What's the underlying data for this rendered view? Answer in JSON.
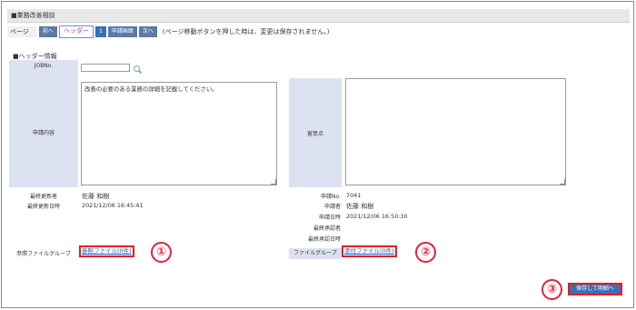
{
  "title": "■業務改善相談",
  "pager": {
    "label": "ページ",
    "prev": "前へ",
    "header_tab": "ヘッダー",
    "page_num": "1",
    "screen_btn": "申請画面",
    "next": "次へ",
    "note": "(ページ移動ボタンを押した時は、変更は保存されません。)"
  },
  "section": "■ヘッダー情報",
  "left": {
    "jobno_label": "JOBNo.",
    "jobno_value": "",
    "content_label": "申請内容",
    "content_text": "改善の必要のある業務の詳細を記載してください。",
    "updater_label": "最終更新者",
    "updater_value": "佐藤 和樹",
    "updated_label": "最終更新日時",
    "updated_value": "2021/12/06 16:45:41",
    "filegroup_label": "参照ファイルグループ",
    "filegroup_link": "参照ファイル(0件)"
  },
  "right": {
    "notes_label": "留意点",
    "notes_text": "",
    "appno_label": "申請No.",
    "appno_value": "7041",
    "applicant_label": "申請者",
    "applicant_value": "佐藤 和樹",
    "appdate_label": "申請日時",
    "appdate_value": "2021/12/06 16:50:30",
    "approver_label": "最終承認者",
    "approver_value": "",
    "approvedate_label": "最終承認日時",
    "approvedate_value": "",
    "filegroup_label": "ファイルグループ",
    "filegroup_link": "添付ファイル(0件)"
  },
  "markers": [
    "①",
    "②",
    "③"
  ],
  "save_button": "保存して明細へ"
}
